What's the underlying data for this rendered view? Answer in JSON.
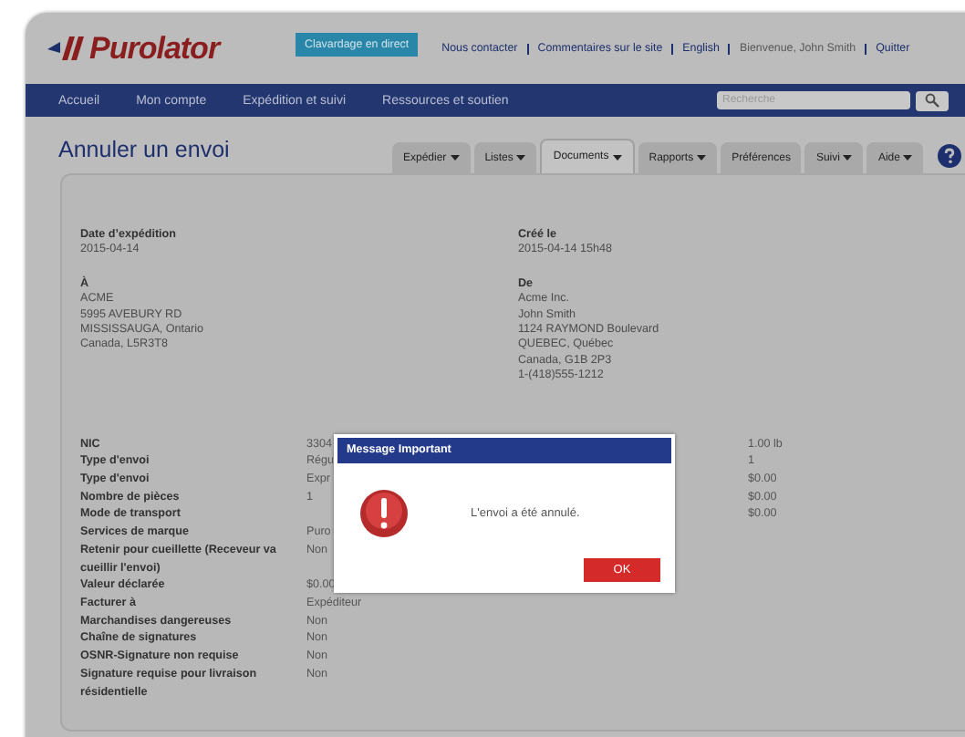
{
  "header": {
    "logo": "Purolator",
    "chat_button": "Clavardage en direct",
    "links": [
      {
        "text": "Nous contacter",
        "kind": "link"
      },
      {
        "text": "Commentaires sur le site",
        "kind": "link"
      },
      {
        "text": "English",
        "kind": "link"
      },
      {
        "text": "Bienvenue, John Smith",
        "kind": "greeting"
      },
      {
        "text": "Quitter",
        "kind": "link"
      }
    ]
  },
  "nav": {
    "items": [
      "Accueil",
      "Mon compte",
      "Expédition et suivi",
      "Ressources et soutien"
    ],
    "search": {
      "placeholder": "Recherche"
    }
  },
  "page_title": "Annuler un envoi",
  "tabs": [
    {
      "label": "Expédier",
      "menu": true,
      "selected": false
    },
    {
      "label": "Listes",
      "menu": true,
      "selected": false
    },
    {
      "label": "Documents",
      "menu": true,
      "selected": true
    },
    {
      "label": "Rapports",
      "menu": true,
      "selected": false
    },
    {
      "label": "Préférences",
      "menu": false,
      "selected": false
    },
    {
      "label": "Suivi",
      "menu": true,
      "selected": false
    },
    {
      "label": "Aide",
      "menu": true,
      "selected": false
    }
  ],
  "summary": [
    {
      "label": "Date d’expédition",
      "lines": [
        "2015-04-14"
      ]
    },
    {
      "label": "Créé le",
      "lines": [
        "2015-04-14 15h48"
      ]
    },
    {
      "label": "À",
      "lines": [
        "ACME",
        "5995 AVEBURY RD",
        "MISSISSAUGA, Ontario",
        "Canada, L5R3T8"
      ]
    },
    {
      "label": "De",
      "lines": [
        "Acme Inc.",
        "John Smith",
        "1124 RAYMOND Boulevard",
        "QUEBEC, Québec",
        "Canada, G1B 2P3",
        "1-(418)555-1212"
      ]
    }
  ],
  "details": [
    {
      "label": "NIC",
      "value": "3304",
      "right_value": "1.00 lb"
    },
    {
      "label": "Type d'envoi",
      "value": "Régu",
      "right_value": "1"
    },
    {
      "label": "Type d'envoi",
      "value": "Expr",
      "right_value": "$0.00"
    },
    {
      "label": "Nombre de pièces",
      "value": "1",
      "right_value": "$0.00"
    },
    {
      "label": "Mode de transport",
      "right_value": "$0.00"
    },
    {
      "label": "Services de marque",
      "value": "Puro"
    },
    {
      "label": "Retenir pour cueillette (Receveur va cueillir l'envoi)",
      "value": "Non"
    },
    {
      "label": "Valeur déclarée",
      "value": "$0.00"
    },
    {
      "label": "Facturer à",
      "value": "Expéditeur"
    },
    {
      "label": "Marchandises dangereuses",
      "value": "Non"
    },
    {
      "label": "Chaîne de signatures",
      "value": "Non"
    },
    {
      "label": "OSNR-Signature non requise",
      "value": "Non"
    },
    {
      "label": "Signature requise pour livraison résidentielle",
      "value": "Non"
    }
  ],
  "dialog": {
    "title": "Message Important",
    "message": "L'envoi a été annulé.",
    "button": "OK"
  }
}
